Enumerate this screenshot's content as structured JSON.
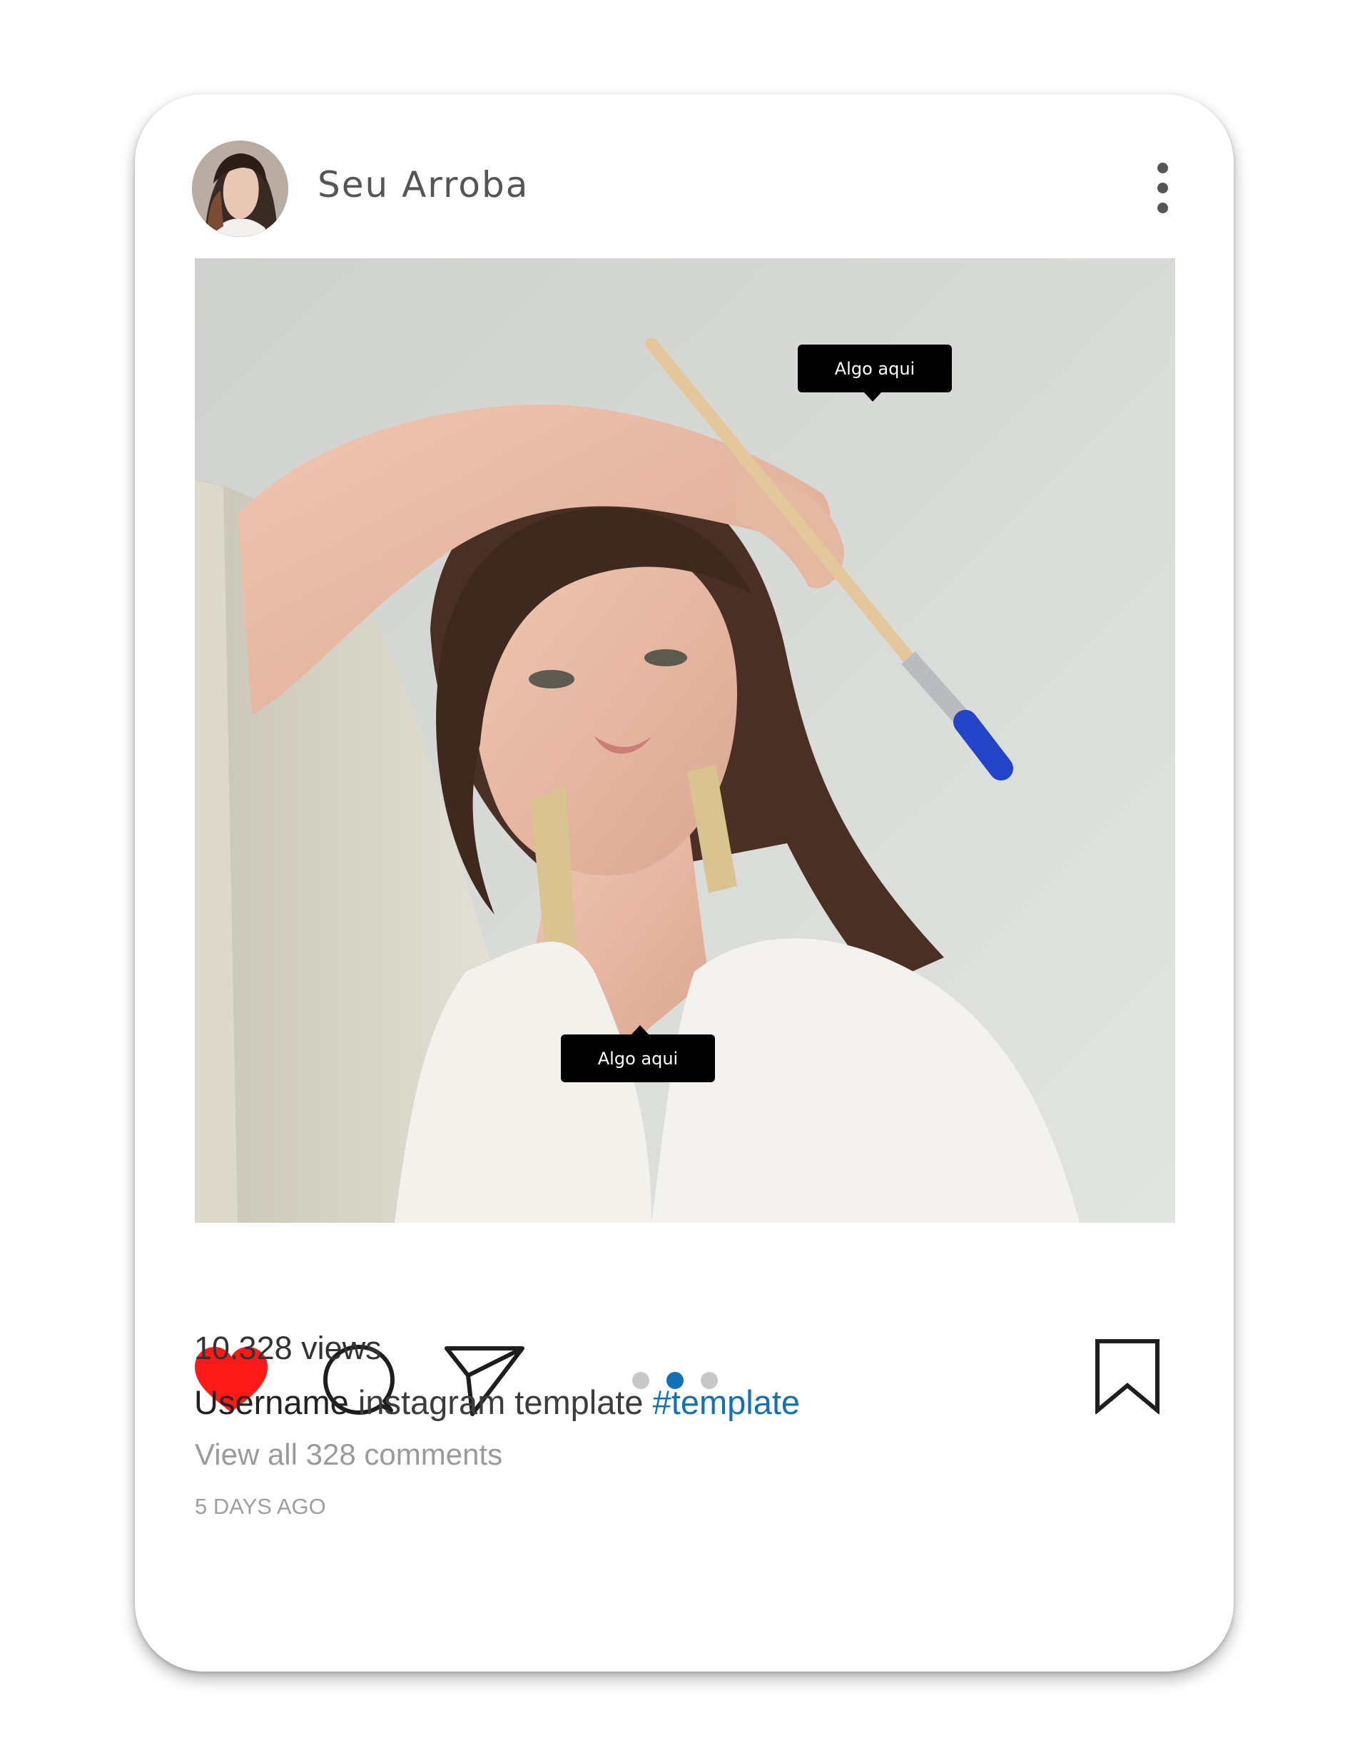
{
  "post": {
    "handle": "Seu Arroba",
    "tags": [
      {
        "label": "Algo aqui"
      },
      {
        "label": "Algo aqui"
      }
    ],
    "views": "10.328 views",
    "caption": {
      "username": "Username",
      "text": "instagram template",
      "hashtag": "#template"
    },
    "comments_link": "View all 328 comments",
    "timestamp": "5 DAYS AGO"
  },
  "carousel": {
    "pages": 3,
    "active_page": 2,
    "active_color": "#1270b8",
    "inactive_color": "#c8c8c8"
  },
  "actions": {
    "liked": true,
    "like_color": "#ff1a1a",
    "icons": [
      "heart-icon",
      "comment-icon",
      "share-icon",
      "bookmark-icon"
    ]
  },
  "header": {
    "menu_icon": "more-vertical-icon"
  }
}
